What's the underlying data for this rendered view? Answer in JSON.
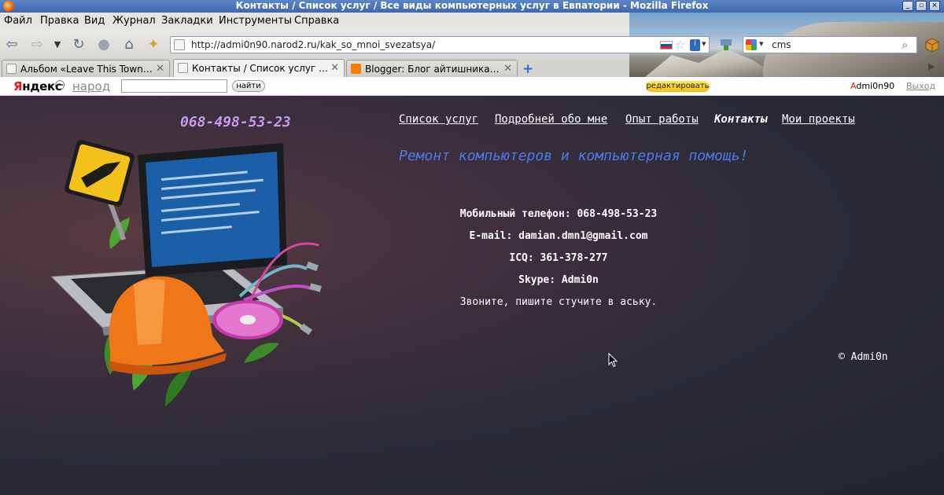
{
  "window": {
    "title": "Контакты / Список услуг / Все виды компьютерных услуг в Евпатории - Mozilla Firefox",
    "buttons": [
      "_",
      "▫",
      "×"
    ]
  },
  "menu": [
    "Файл",
    "Правка",
    "Вид",
    "Журнал",
    "Закладки",
    "Инструменты",
    "Справка"
  ],
  "address_bar": {
    "url": "http://admi0n90.narod2.ru/kak_so_mnoi_svezatsya/"
  },
  "search_bar": {
    "value": "cms"
  },
  "tabs": [
    {
      "label": "Альбом «Leave This Town…",
      "active": false
    },
    {
      "label": "Контакты / Список услуг …",
      "active": true
    },
    {
      "label": "Blogger: Блог айтишника…",
      "active": false
    }
  ],
  "yandex_bar": {
    "logo_first": "Я",
    "logo_rest": "ндекс",
    "narod": "народ",
    "find_button": "найти",
    "edit_button": "редактировать",
    "user_first": "A",
    "user_rest": "dmi0n90",
    "logout": "Выход"
  },
  "page": {
    "phone": "068-498-53-23",
    "nav": [
      "Список услуг",
      "Подробней обо мне",
      "Опыт работы",
      "Контакты",
      "Мои проекты"
    ],
    "active_nav": "Контакты",
    "slogan": "Ремонт компьютеров и компьютерная помощь!",
    "contacts": {
      "mobile": "Мобильный телефон: 068-498-53-23",
      "email": "E-mail: damian.dmn1@gmail.com",
      "icq": "ICQ: 361-378-277",
      "skype": "Skype: Admi0n",
      "note": "Звоните, пишите стучите в аську."
    },
    "copyright": "© Admi0n"
  },
  "colors": {
    "phone": "#c79bf0",
    "slogan": "#4f79e8",
    "titlebar": "#4a74bb"
  }
}
